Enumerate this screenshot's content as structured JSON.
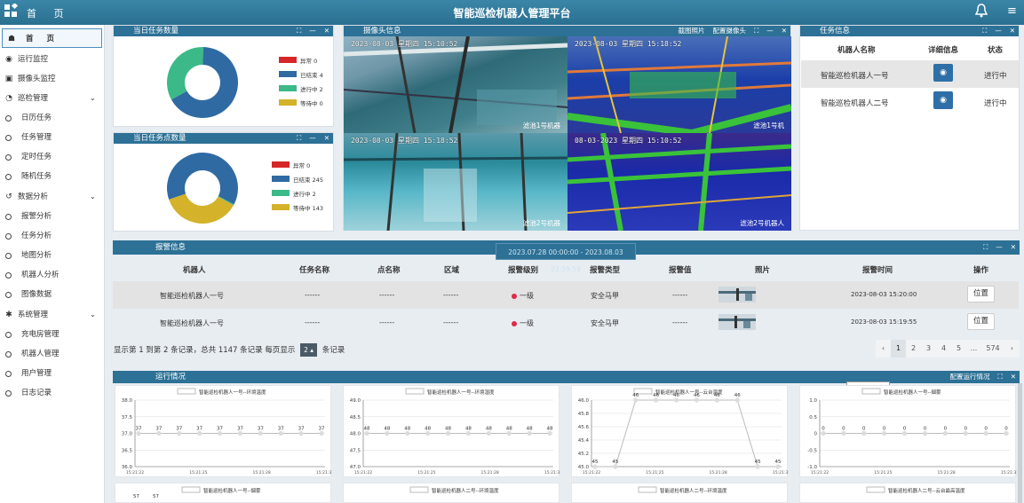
{
  "header": {
    "home": "首 页",
    "title": "智能巡检机器人管理平台"
  },
  "sidebar": {
    "items": [
      {
        "label": "首 页",
        "icon": "home-icon",
        "glyph": "☗"
      },
      {
        "label": "运行监控",
        "icon": "eye-icon",
        "glyph": "◉"
      },
      {
        "label": "摄像头监控",
        "icon": "camera-icon",
        "glyph": "▣"
      },
      {
        "label": "巡检管理",
        "icon": "pie-icon",
        "glyph": "◔"
      },
      {
        "label": "日历任务"
      },
      {
        "label": "任务管理"
      },
      {
        "label": "定时任务"
      },
      {
        "label": "随机任务"
      },
      {
        "label": "数据分析",
        "icon": "history-icon",
        "glyph": "↺"
      },
      {
        "label": "报警分析"
      },
      {
        "label": "任务分析"
      },
      {
        "label": "地图分析"
      },
      {
        "label": "机器人分析"
      },
      {
        "label": "图像数据"
      },
      {
        "label": "系统管理",
        "icon": "gear-icon",
        "glyph": "✱"
      },
      {
        "label": "充电房管理"
      },
      {
        "label": "机器人管理"
      },
      {
        "label": "用户管理"
      },
      {
        "label": "日志记录"
      }
    ]
  },
  "panels": {
    "task_count": {
      "title": "当日任务数量"
    },
    "point_count": {
      "title": "当日任务点数量"
    },
    "camera": {
      "title": "摄像头信息",
      "tool1": "截图照片",
      "tool2": "配置摄像头"
    },
    "task_info": {
      "title": "任务信息"
    },
    "alarm": {
      "title": "报警信息",
      "range": "2023.07.28 00:00:00 - 2023.08.03 23:59:59"
    },
    "run": {
      "title": "运行情况",
      "tool1": "配置运行情况",
      "tooltip": "截图(Alt + A)"
    }
  },
  "charts": {
    "task_donut": {
      "legend": [
        "异常 0",
        "已结束 4",
        "进行中 2",
        "等待中 0"
      ],
      "values": [
        0,
        4,
        2,
        0
      ],
      "colors": [
        "#d62728",
        "#2f6aa3",
        "#3cb988",
        "#d4b22a"
      ]
    },
    "point_donut": {
      "legend": [
        "异常 0",
        "已结束 245",
        "进行中 2",
        "等待中 143"
      ],
      "values": [
        0,
        245,
        2,
        143
      ],
      "colors": [
        "#d62728",
        "#2f6aa3",
        "#3cb988",
        "#d4b22a"
      ]
    }
  },
  "cameras": [
    {
      "timestamp": "2023-08-03 星期四 15:10:52",
      "label": "滤池1号机器"
    },
    {
      "timestamp": "2023-08-03 星期四 15:18:52",
      "label": "滤池1号机"
    },
    {
      "timestamp": "2023-08-03 星期四 15:18:52",
      "label": "滤池2号机器"
    },
    {
      "timestamp": "08-03-2023 星期四 15:10:52",
      "label": "滤池2号机器人"
    }
  ],
  "task_table": {
    "headers": [
      "机器人名称",
      "详细信息",
      "状态"
    ],
    "rows": [
      {
        "name": "智能巡检机器人一号",
        "status": "进行中"
      },
      {
        "name": "智能巡检机器人二号",
        "status": "进行中"
      }
    ]
  },
  "alarm_table": {
    "headers": [
      "机器人",
      "任务名称",
      "点名称",
      "区域",
      "报警级别",
      "报警类型",
      "报警值",
      "照片",
      "报警时间",
      "操作"
    ],
    "rows": [
      {
        "robot": "智能巡检机器人一号",
        "task": "------",
        "point": "------",
        "area": "------",
        "level": "一级",
        "type": "安全马甲",
        "value": "------",
        "time": "2023-08-03 15:20:00",
        "op": "位置"
      },
      {
        "robot": "智能巡检机器人一号",
        "task": "------",
        "point": "------",
        "area": "------",
        "level": "一级",
        "type": "安全马甲",
        "value": "------",
        "time": "2023-08-03 15:19:55",
        "op": "位置"
      }
    ],
    "footer_pre": "显示第 1 到第 2 条记录，总共 1147 条记录  每页显示",
    "page_size": "2 ▴",
    "footer_post": "条记录",
    "pages": [
      "‹",
      "1",
      "2",
      "3",
      "4",
      "5",
      "...",
      "574",
      "›"
    ]
  },
  "chart_data": [
    {
      "type": "line",
      "title": "智能巡检机器人一号--环境温度",
      "series": [
        {
          "name": "智能巡检机器人一号--环境温度",
          "values": [
            37,
            37,
            37,
            37,
            37,
            37,
            37,
            37,
            37,
            37
          ]
        }
      ],
      "ylim": [
        36.0,
        38.0
      ],
      "yticks": [
        "38.0",
        "37.5",
        "37.0",
        "36.5",
        "36.0"
      ],
      "x": [
        "15:21:22",
        "15:21:25",
        "15:21:28",
        "15:21:31"
      ]
    },
    {
      "type": "line",
      "title": "智能巡检机器人一号--环境湿度",
      "series": [
        {
          "name": "智能巡检机器人一号--环境湿度",
          "values": [
            48,
            48,
            48,
            48,
            48,
            48,
            48,
            48,
            48,
            48
          ]
        }
      ],
      "ylim": [
        47.0,
        49.0
      ],
      "yticks": [
        "49.0",
        "48.5",
        "48.0",
        "47.5",
        "47.0"
      ],
      "x": [
        "15:21:22",
        "15:21:25",
        "15:21:28",
        "15:21:31"
      ]
    },
    {
      "type": "line",
      "title": "智能巡检机器人一号--云台温度",
      "series": [
        {
          "name": "智能巡检机器人一号--云台温度",
          "values": [
            45,
            45,
            46,
            46,
            46,
            46,
            46,
            46,
            45,
            45
          ]
        }
      ],
      "ylim": [
        45.0,
        46.0
      ],
      "yticks": [
        "46.0",
        "45.8",
        "45.6",
        "45.4",
        "45.2",
        "45.0"
      ],
      "x": [
        "15:21:22",
        "15:21:25",
        "15:21:28",
        "15:21:31"
      ]
    },
    {
      "type": "line",
      "title": "智能巡检机器人一号--烟雾",
      "series": [
        {
          "name": "智能巡检机器人一号--烟雾",
          "values": [
            0,
            0,
            0,
            0,
            0,
            0,
            0,
            0,
            0,
            0
          ]
        }
      ],
      "ylim": [
        -1.0,
        1.0
      ],
      "yticks": [
        "1.0",
        "0.5",
        "0",
        "-0.5",
        "-1.0"
      ],
      "x": [
        "15:21:22",
        "15:21:25",
        "15:21:28",
        "15:21:31"
      ]
    }
  ],
  "charts_row2": [
    "智能巡检机器人一号--烟雾",
    "智能巡检机器人二号--环境温度",
    "智能巡检机器人二号--环境温度",
    "智能巡检机器人二号--云台最高温度"
  ],
  "row2_first_values": [
    "57",
    "57"
  ]
}
